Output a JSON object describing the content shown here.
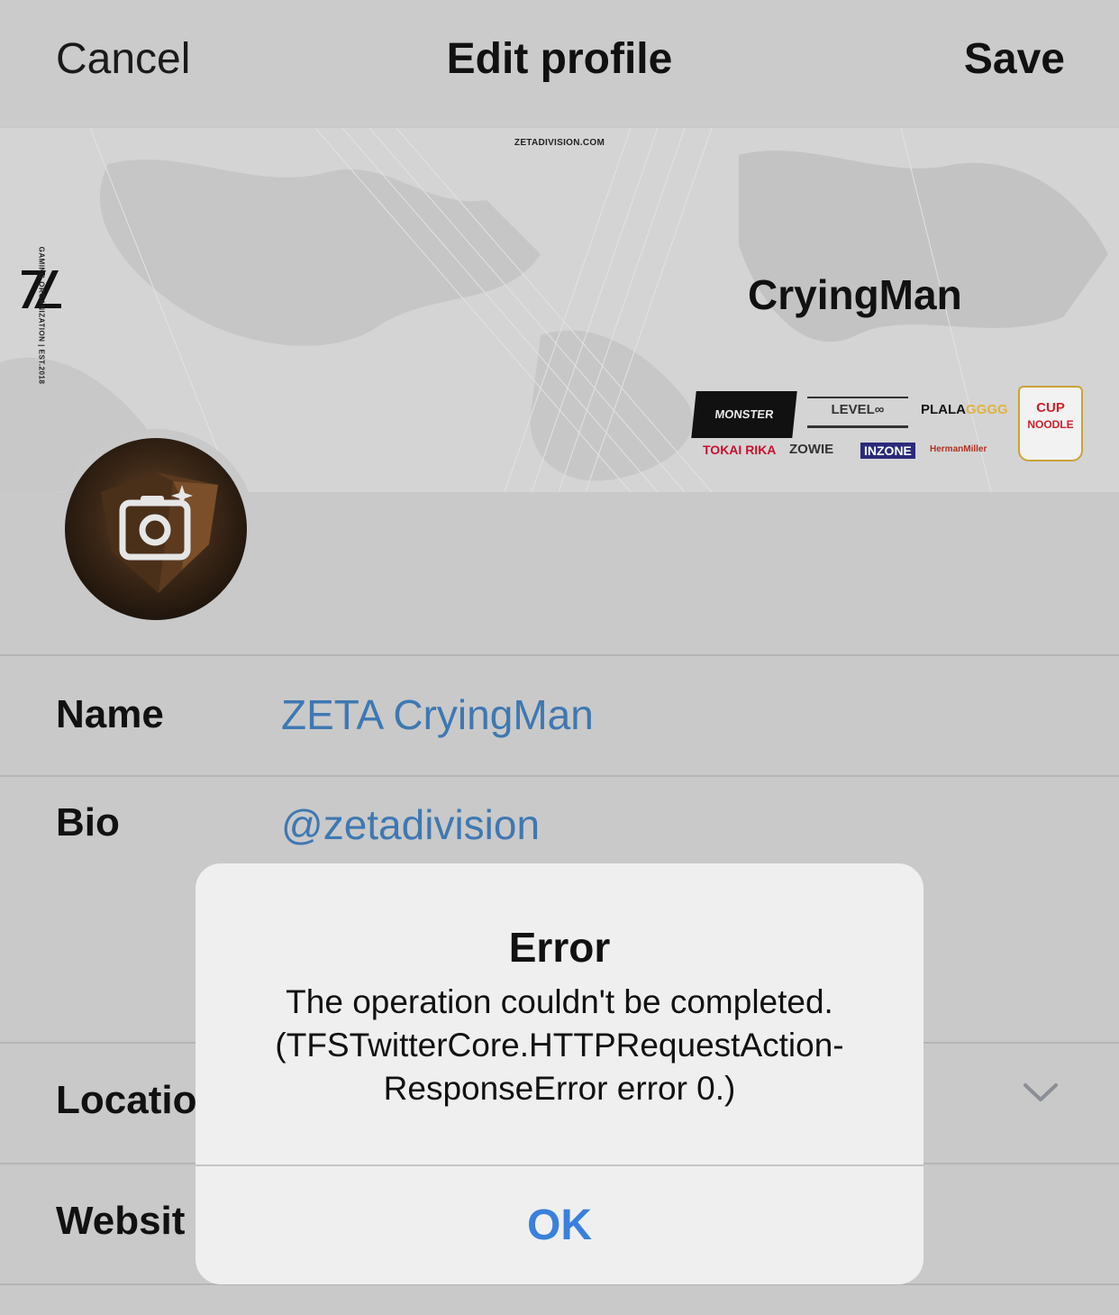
{
  "navbar": {
    "cancel_label": "Cancel",
    "title": "Edit profile",
    "save_label": "Save"
  },
  "banner": {
    "url_text": "ZETADIVISION.COM",
    "vertical_text": "GAMING ORGANIZATION | EST.2018",
    "handle_text": "CryingMan",
    "sponsors": {
      "monster": "MONSTER",
      "level": "LEVEL∞",
      "plala_a": "PLALA",
      "plala_b": "GGGG",
      "tokai": "TOKAI RIKA",
      "zowie": "ZOWIE",
      "inzone": "INZONE",
      "herman": "HermanMiller",
      "cup_a": "CUP",
      "cup_b": "NOODLE"
    }
  },
  "form": {
    "name_label": "Name",
    "name_value": "ZETA CryingMan",
    "bio_label": "Bio",
    "bio_value": "@zetadivision",
    "location_label": "Locatio",
    "website_label": "Websit"
  },
  "alert": {
    "title": "Error",
    "message": "The operation couldn't be completed. (TFSTwitterCore.HTTPRequestAction-ResponseError error 0.)",
    "ok_label": "OK"
  },
  "colors": {
    "link_blue": "#3e78b2",
    "alert_button_blue": "#3a80dc",
    "background": "#c9c9c9"
  }
}
